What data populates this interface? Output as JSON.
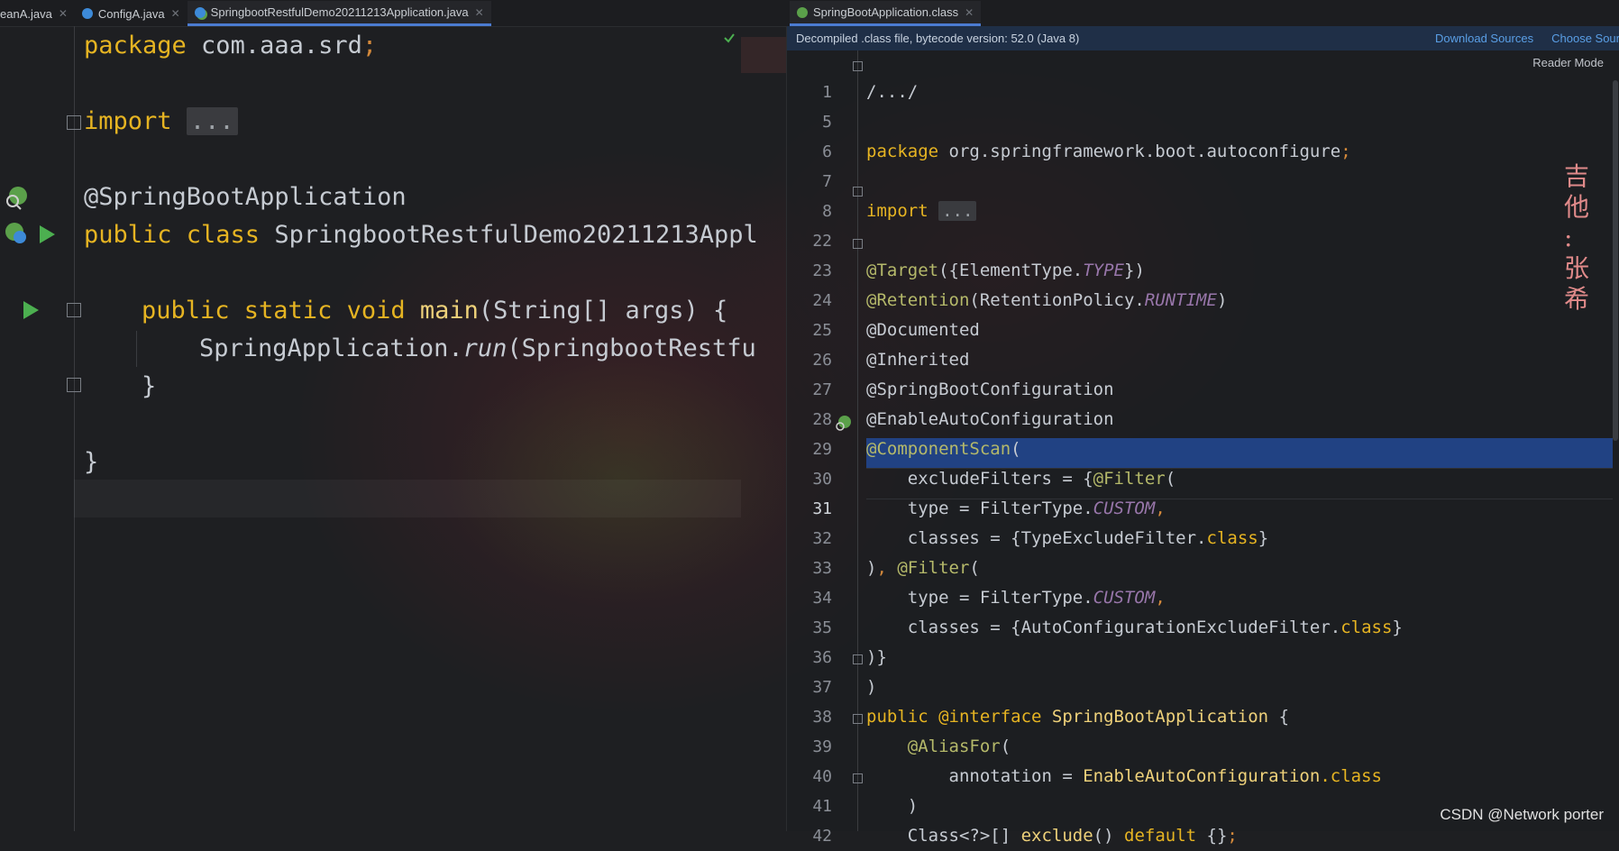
{
  "left_tabs": [
    {
      "label": "eanA.java"
    },
    {
      "label": "ConfigA.java"
    },
    {
      "label": "SpringbootRestfulDemo20211213Application.java"
    }
  ],
  "right_tab": {
    "label": "SpringBootApplication.class"
  },
  "banner": {
    "message": "Decompiled .class file, bytecode version: 52.0 (Java 8)",
    "download_sources": "Download Sources",
    "choose_sources": "Choose Sour"
  },
  "reader_mode": "Reader Mode",
  "left_code": {
    "l1_kw": "package",
    "l1_rest": " com.aaa.srd",
    "l1_semi": ";",
    "l2_kw": "import",
    "l2_dots": "...",
    "l3": "@SpringBootApplication",
    "l4_kw": "public class",
    "l4_rest": " SpringbootRestfulDemo20211213Appl",
    "l5_kw": "public static void",
    "l5_fn": " main",
    "l5_rest": "(String[] args) {",
    "l6_a": "SpringApplication.",
    "l6_b": "run",
    "l6_c": "(SpringbootRestfu",
    "l7": "}",
    "l8": "}"
  },
  "right_lines": [
    {
      "n": "1"
    },
    {
      "n": "5"
    },
    {
      "n": "6"
    },
    {
      "n": "7"
    },
    {
      "n": "8"
    },
    {
      "n": "22"
    },
    {
      "n": "23"
    },
    {
      "n": "24"
    },
    {
      "n": "25"
    },
    {
      "n": "26"
    },
    {
      "n": "27"
    },
    {
      "n": "28"
    },
    {
      "n": "29"
    },
    {
      "n": "30"
    },
    {
      "n": "31"
    },
    {
      "n": "32"
    },
    {
      "n": "33"
    },
    {
      "n": "34"
    },
    {
      "n": "35"
    },
    {
      "n": "36"
    },
    {
      "n": "37"
    },
    {
      "n": "38"
    },
    {
      "n": "39"
    },
    {
      "n": "40"
    },
    {
      "n": "41"
    },
    {
      "n": "42"
    }
  ],
  "right_code": {
    "r1": "/.../",
    "r6_kw": "package",
    "r6_rest": " org.springframework.boot.autoconfigure",
    "r6_semi": ";",
    "r8_kw": "import",
    "r8_dots": "...",
    "r23_a": "@Target",
    "r23_b": "({ElementType.",
    "r23_c": "TYPE",
    "r23_d": "})",
    "r24_a": "@Retention",
    "r24_b": "(RetentionPolicy.",
    "r24_c": "RUNTIME",
    "r24_d": ")",
    "r25": "@Documented",
    "r26": "@Inherited",
    "r27": "@SpringBootConfiguration",
    "r28": "@EnableAutoConfiguration",
    "r29_a": "@ComponentScan",
    "r29_b": "(",
    "r30_a": "    excludeFilters = {",
    "r30_b": "@Filter",
    "r30_c": "(",
    "r31_a": "    type = FilterType.",
    "r31_b": "CUSTOM",
    "r31_c": ",",
    "r32_a": "    classes = {TypeExcludeFilter.",
    "r32_b": "class",
    "r32_c": "}",
    "r33_a": ")",
    "r33_b": ", ",
    "r33_c": "@Filter",
    "r33_d": "(",
    "r34_a": "    type = FilterType.",
    "r34_b": "CUSTOM",
    "r34_c": ",",
    "r35_a": "    classes = {AutoConfigurationExcludeFilter.",
    "r35_b": "class",
    "r35_c": "}",
    "r36": ")}",
    "r37": ")",
    "r38_a": "public ",
    "r38_b": "@interface",
    "r38_c": " SpringBootApplication ",
    "r38_d": "{",
    "r39_a": "    @AliasFor",
    "r39_b": "(",
    "r40_a": "        annotation = ",
    "r40_b": "EnableAutoConfiguration",
    "r40_c": ".class",
    "r41": "    )",
    "r42_a": "    Class<?>[] ",
    "r42_b": "exclude",
    "r42_c": "() ",
    "r42_d": "default",
    "r42_e": " {}",
    "r42_f": ";"
  },
  "watermark_top": "吉\n他\n:\n张\n希",
  "csdn": "CSDN @Network porter",
  "colors": {
    "keyword": "#e6b422",
    "annotation": "#b5b96a",
    "selection": "#214283",
    "link": "#5a9fe6"
  }
}
